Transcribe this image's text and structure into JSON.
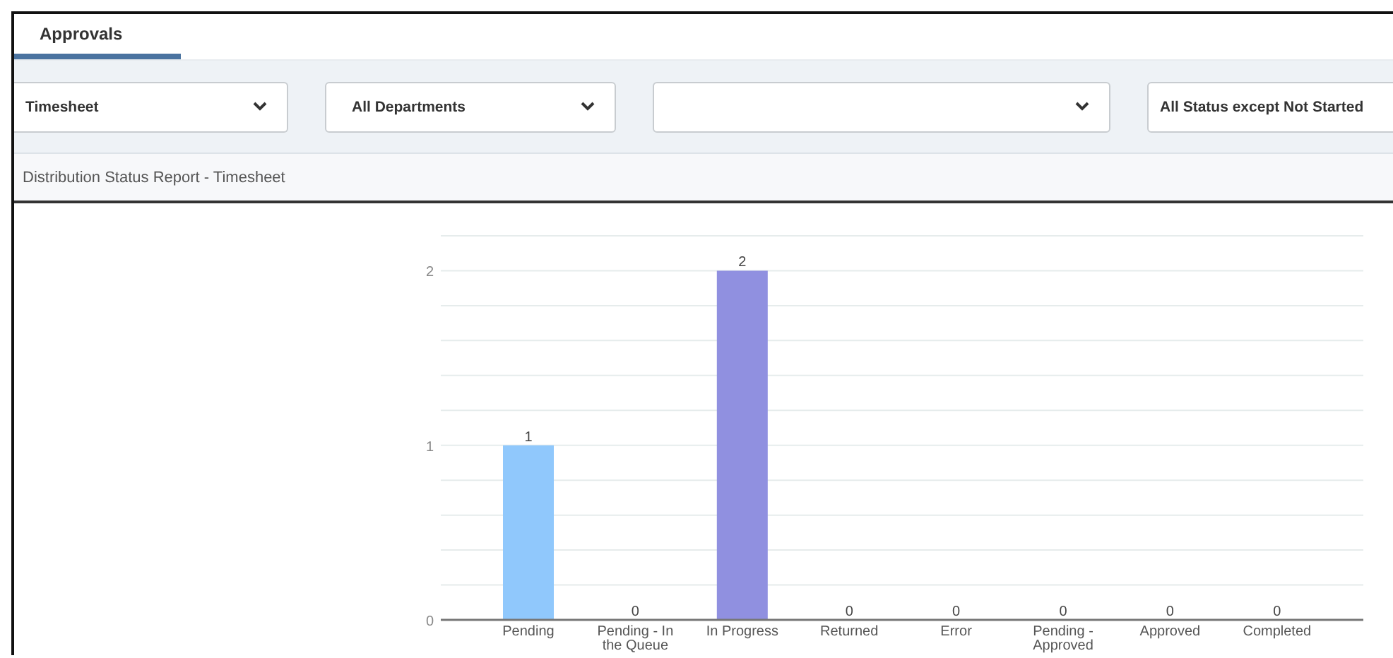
{
  "tabs": [
    {
      "label": "Approvals",
      "selected": true
    }
  ],
  "filters": [
    {
      "kind": "select",
      "value": "Timesheet",
      "chevron": true
    },
    {
      "kind": "select",
      "value": "All Departments",
      "chevron": true
    },
    {
      "kind": "select",
      "chevron": true
    },
    {
      "kind": "select",
      "value": "All Status except Not Started",
      "chevron": false
    }
  ],
  "report": {
    "title": "Distribution Status Report - Timesheet",
    "chart_data": {
      "type": "bar",
      "categories": [
        "Pending",
        "Pending - In the Queue",
        "In Progress",
        "Returned",
        "Error",
        "Pending - Approved",
        "Approved",
        "Completed"
      ],
      "series": [
        {
          "color": "#90c8fc",
          "colors": [
            null,
            null,
            "#9090e0",
            null,
            null,
            null,
            null,
            null
          ],
          "values": [
            1,
            0,
            2,
            0,
            0,
            0,
            0,
            0
          ]
        }
      ],
      "ylim": [
        0,
        2.2
      ],
      "yticks": [
        0,
        1,
        2
      ],
      "data_labels": true
    }
  }
}
